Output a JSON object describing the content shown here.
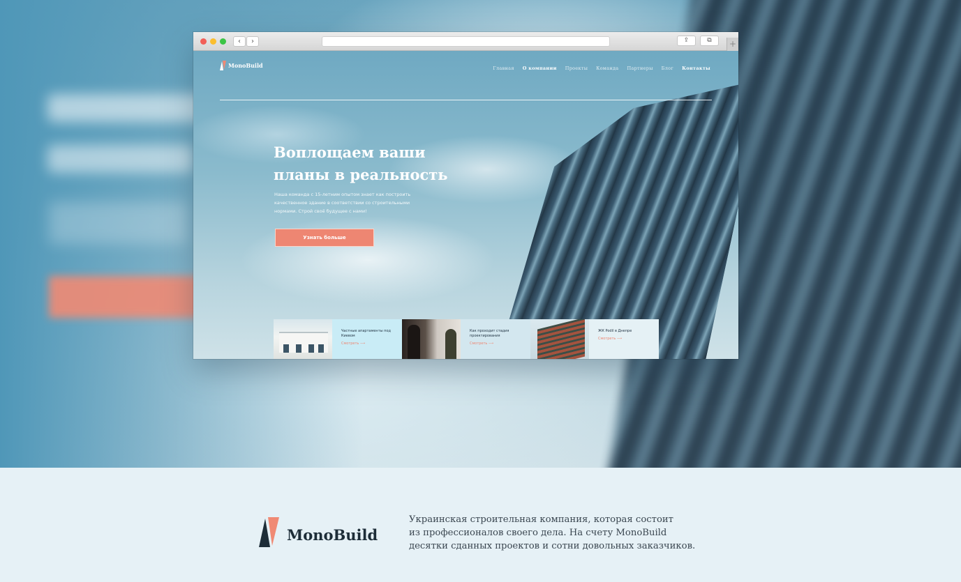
{
  "site": {
    "logo_text": "MonoBuild",
    "nav": [
      "Главная",
      "О компании",
      "Проекты",
      "Команда",
      "Партнеры",
      "Блог",
      "Контакты"
    ],
    "hero_title_line1": "Воплощаем ваши",
    "hero_title_line2": "планы в реальность",
    "hero_text": "Наша команда с 15-летним опытом знает как построить качественное здание в соответствии со строительными нормами. Строй своё будущее с нами!",
    "hero_button": "Узнать больше",
    "cards": [
      {
        "title": "Частные апартаменты под Киевом",
        "link": "Смотреть ⟶"
      },
      {
        "title": "Как проходит стадия проектирования",
        "link": "Смотреть ⟶"
      },
      {
        "title": "ЖК Podil в Днепре",
        "link": "Смотреть ⟶"
      }
    ]
  },
  "footer": {
    "logo_text": "MonoBuild",
    "description_lines": [
      "Украинская строительная компания, которая состоит",
      "из профессионалов своего дела. На счету MonoBuild",
      "десятки сданных проектов и сотни довольных заказчиков."
    ]
  },
  "colors": {
    "accent": "#ee8672",
    "dark": "#1d2d38",
    "footer_bg": "#e6f1f6"
  }
}
